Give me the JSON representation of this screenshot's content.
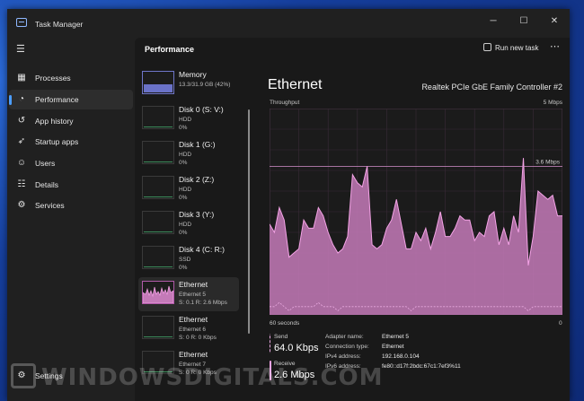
{
  "app": {
    "title": "Task Manager"
  },
  "window_controls": {
    "minimize": "─",
    "maximize": "☐",
    "close": "✕"
  },
  "sidebar": {
    "items": [
      {
        "label": "Processes",
        "icon": "processes-icon"
      },
      {
        "label": "Performance",
        "icon": "performance-icon"
      },
      {
        "label": "App history",
        "icon": "app-history-icon"
      },
      {
        "label": "Startup apps",
        "icon": "startup-apps-icon"
      },
      {
        "label": "Users",
        "icon": "users-icon"
      },
      {
        "label": "Details",
        "icon": "details-icon"
      },
      {
        "label": "Services",
        "icon": "services-icon"
      }
    ],
    "settings_label": "Settings"
  },
  "header": {
    "title": "Performance",
    "run_new_task": "Run new task"
  },
  "resources": [
    {
      "name": "Memory",
      "line1": "13.3/31.9 GB (42%)",
      "line2": ""
    },
    {
      "name": "Disk 0 (S: V:)",
      "line1": "HDD",
      "line2": "0%"
    },
    {
      "name": "Disk 1 (G:)",
      "line1": "HDD",
      "line2": "0%"
    },
    {
      "name": "Disk 2 (Z:)",
      "line1": "HDD",
      "line2": "0%"
    },
    {
      "name": "Disk 3 (Y:)",
      "line1": "HDD",
      "line2": "0%"
    },
    {
      "name": "Disk 4 (C: R:)",
      "line1": "SSD",
      "line2": "0%"
    },
    {
      "name": "Ethernet",
      "line1": "Ethernet 5",
      "line2": "S: 0.1 R: 2.6 Mbps"
    },
    {
      "name": "Ethernet",
      "line1": "Ethernet 6",
      "line2": "S: 0 R: 0 Kbps"
    },
    {
      "name": "Ethernet",
      "line1": "Ethernet 7",
      "line2": "S: 0 R: 0 Kbps"
    }
  ],
  "detail": {
    "title": "Ethernet",
    "adapter_desc": "Realtek PCIe GbE Family Controller #2",
    "throughput_label": "Throughput",
    "max_label": "5 Mbps",
    "ref_label": "3.6 Mbps",
    "time_label": "60 seconds",
    "zero_label": "0"
  },
  "stats": {
    "send_label": "Send",
    "send_value": "64.0 Kbps",
    "receive_label": "Receive",
    "receive_value": "2.6 Mbps"
  },
  "info": {
    "adapter_name_k": "Adapter name:",
    "adapter_name_v": "Ethernet 5",
    "conn_type_k": "Connection type:",
    "conn_type_v": "Ethernet",
    "ipv4_k": "IPv4 address:",
    "ipv4_v": "192.168.0.104",
    "ipv6_k": "IPv6 address:",
    "ipv6_v": "fe80::d17f:2bdc:67c1:7ef3%11"
  },
  "watermark": "WINDOWSDIGITALS.COM",
  "colors": {
    "receive": "#f4a3e6",
    "receive_fill": "#c47ab8",
    "send": "#e9a9e0",
    "accent": "#4c9eff",
    "memory": "#6a72c8"
  },
  "chart_data": {
    "type": "area",
    "x": [
      0,
      1,
      2,
      3,
      4,
      5,
      6,
      7,
      8,
      9,
      10,
      11,
      12,
      13,
      14,
      15,
      16,
      17,
      18,
      19,
      20,
      21,
      22,
      23,
      24,
      25,
      26,
      27,
      28,
      29,
      30,
      31,
      32,
      33,
      34,
      35,
      36,
      37,
      38,
      39,
      40,
      41,
      42,
      43,
      44,
      45,
      46,
      47,
      48,
      49,
      50,
      51,
      52,
      53,
      54,
      55,
      56,
      57,
      58,
      59,
      60
    ],
    "series": [
      {
        "values": [
          2.2,
          2.0,
          2.6,
          2.3,
          1.4,
          1.5,
          1.6,
          2.3,
          2.1,
          2.1,
          2.6,
          2.4,
          2.0,
          1.7,
          1.5,
          1.6,
          1.9,
          3.4,
          3.2,
          3.1,
          3.6,
          1.7,
          1.6,
          1.7,
          2.1,
          2.3,
          2.8,
          2.2,
          1.6,
          1.6,
          2.0,
          1.8,
          2.1,
          1.6,
          2.0,
          2.5,
          1.9,
          1.9,
          2.1,
          2.4,
          2.3,
          2.3,
          1.8,
          2.0,
          1.9,
          2.4,
          2.5,
          1.7,
          2.1,
          1.7,
          2.4,
          2.0,
          3.8,
          1.2,
          1.9,
          3.0,
          2.9,
          2.8,
          2.9,
          2.4,
          2.4
        ]
      },
      {
        "values": [
          0.2,
          0.2,
          0.3,
          0.2,
          0.1,
          0.2,
          0.2,
          0.2,
          0.2,
          0.2,
          0.3,
          0.2,
          0.2,
          0.2,
          0.1,
          0.2,
          0.2,
          0.2,
          0.2,
          0.2,
          0.2,
          0.2,
          0.2,
          0.2,
          0.2,
          0.2,
          0.2,
          0.2,
          0.2,
          0.1,
          0.2,
          0.2,
          0.2,
          0.2,
          0.2,
          0.2,
          0.2,
          0.2,
          0.2,
          0.2,
          0.2,
          0.2,
          0.2,
          0.2,
          0.2,
          0.2,
          0.2,
          0.2,
          0.2,
          0.2,
          0.2,
          0.2,
          0.2,
          0.1,
          0.2,
          0.2,
          0.2,
          0.2,
          0.2,
          0.2,
          0.2
        ]
      }
    ],
    "ylim": [
      0,
      5
    ],
    "xlim": [
      0,
      60
    ],
    "reference_line": 3.6,
    "grid": true,
    "legend": "none"
  }
}
